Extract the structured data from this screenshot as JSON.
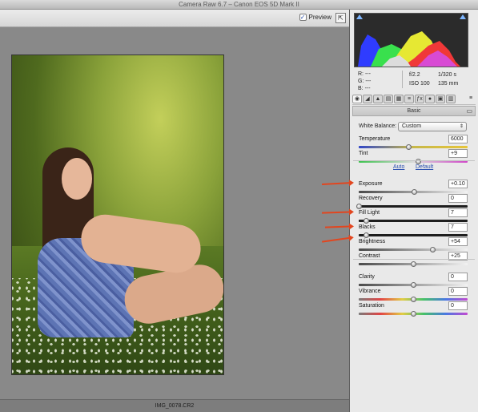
{
  "window": {
    "title": "Camera Raw 6.7  –  Canon EOS 5D Mark II"
  },
  "toolbar": {
    "preview_label": "Preview",
    "preview_checked": "✓",
    "fullscreen_icon": "⇱"
  },
  "filmstrip": {
    "filename": "IMG_0078.CR2"
  },
  "readout": {
    "r_label": "R:",
    "r_value": "---",
    "g_label": "G:",
    "g_value": "---",
    "b_label": "B:",
    "b_value": "---",
    "aperture": "f/2.2",
    "shutter": "1/320 s",
    "iso": "ISO 100",
    "focal": "135 mm"
  },
  "tabs": [
    "◉",
    "◢",
    "▲",
    "▤",
    "▦",
    "≡",
    "ƒx",
    "●",
    "▣",
    "▥"
  ],
  "tab_menu": "≡",
  "section": {
    "title": "Basic",
    "menu": "▭"
  },
  "white_balance": {
    "label": "White Balance:",
    "value": "Custom",
    "arrows": "⇕"
  },
  "links": {
    "auto": "Auto",
    "default": "Default"
  },
  "controls": {
    "temperature": {
      "label": "Temperature",
      "value": "6000",
      "level": 0.46
    },
    "tint": {
      "label": "Tint",
      "value": "+9",
      "level": 0.55
    },
    "exposure": {
      "label": "Exposure",
      "value": "+0.10",
      "level": 0.51
    },
    "recovery": {
      "label": "Recovery",
      "value": "0",
      "level": 0.0
    },
    "fill_light": {
      "label": "Fill Light",
      "value": "7",
      "level": 0.07
    },
    "blacks": {
      "label": "Blacks",
      "value": "7",
      "level": 0.07
    },
    "brightness": {
      "label": "Brightness",
      "value": "+54",
      "level": 0.68
    },
    "contrast": {
      "label": "Contrast",
      "value": "+25",
      "level": 0.5
    },
    "clarity": {
      "label": "Clarity",
      "value": "0",
      "level": 0.5
    },
    "vibrance": {
      "label": "Vibrance",
      "value": "0",
      "level": 0.5
    },
    "saturation": {
      "label": "Saturation",
      "value": "0",
      "level": 0.5
    }
  },
  "colors": {
    "annotation_arrow": "#e2461f",
    "link": "#2a4fb0",
    "clip_warning": "#7eb6ff"
  }
}
